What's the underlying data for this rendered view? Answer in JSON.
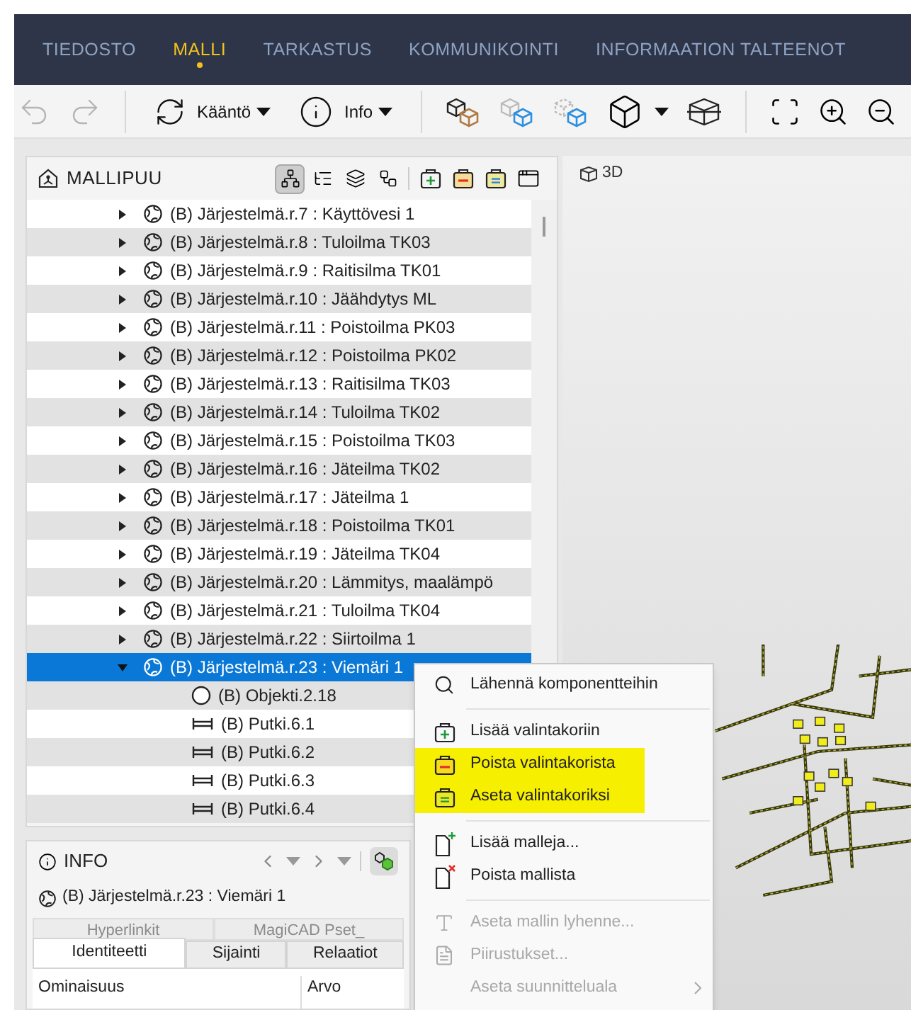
{
  "nav": {
    "tabs": [
      {
        "label": "TIEDOSTO",
        "selected": false
      },
      {
        "label": "MALLI",
        "selected": true
      },
      {
        "label": "TARKASTUS",
        "selected": false
      },
      {
        "label": "KOMMUNIKOINTI",
        "selected": false
      },
      {
        "label": "INFORMAATION TALTEENOT",
        "selected": false
      }
    ]
  },
  "toolbar": {
    "items": [
      {
        "kind": "undo",
        "disabled": true
      },
      {
        "kind": "redo",
        "disabled": true
      },
      {
        "kind": "separator"
      },
      {
        "kind": "rotate",
        "label": "Kääntö",
        "dropdown": true
      },
      {
        "kind": "info",
        "label": "Info",
        "dropdown": true
      },
      {
        "kind": "separator"
      },
      {
        "kind": "cubes-color"
      },
      {
        "kind": "cubes-ghost"
      },
      {
        "kind": "cubes-dashed"
      },
      {
        "kind": "cube",
        "dropdown": true
      },
      {
        "kind": "section-box"
      },
      {
        "kind": "separator"
      },
      {
        "kind": "zoom-fit"
      },
      {
        "kind": "zoom-in"
      },
      {
        "kind": "zoom-out"
      }
    ]
  },
  "model_tree": {
    "title": "MALLIPUU",
    "tools": [
      {
        "kind": "tree",
        "selected": true
      },
      {
        "kind": "list",
        "selected": false
      },
      {
        "kind": "layers",
        "selected": false
      },
      {
        "kind": "hierarchy",
        "selected": false
      },
      {
        "kind": "separator"
      },
      {
        "kind": "basket-add",
        "selected": false
      },
      {
        "kind": "basket-remove",
        "selected": false
      },
      {
        "kind": "basket-set",
        "selected": false
      },
      {
        "kind": "window",
        "selected": false
      }
    ],
    "rows": [
      {
        "kind": "system",
        "label": "(B) Järjestelmä.r.7 : Käyttövesi 1",
        "expanded": false,
        "selected": false
      },
      {
        "kind": "system",
        "label": "(B) Järjestelmä.r.8 : Tuloilma TK03",
        "expanded": false,
        "selected": false
      },
      {
        "kind": "system",
        "label": "(B) Järjestelmä.r.9 : Raitisilma TK01",
        "expanded": false,
        "selected": false
      },
      {
        "kind": "system",
        "label": "(B) Järjestelmä.r.10 : Jäähdytys ML",
        "expanded": false,
        "selected": false
      },
      {
        "kind": "system",
        "label": "(B) Järjestelmä.r.11 : Poistoilma PK03",
        "expanded": false,
        "selected": false
      },
      {
        "kind": "system",
        "label": "(B) Järjestelmä.r.12 : Poistoilma PK02",
        "expanded": false,
        "selected": false
      },
      {
        "kind": "system",
        "label": "(B) Järjestelmä.r.13 : Raitisilma TK03",
        "expanded": false,
        "selected": false
      },
      {
        "kind": "system",
        "label": "(B) Järjestelmä.r.14 : Tuloilma TK02",
        "expanded": false,
        "selected": false
      },
      {
        "kind": "system",
        "label": "(B) Järjestelmä.r.15 : Poistoilma TK03",
        "expanded": false,
        "selected": false
      },
      {
        "kind": "system",
        "label": "(B) Järjestelmä.r.16 : Jäteilma TK02",
        "expanded": false,
        "selected": false
      },
      {
        "kind": "system",
        "label": "(B) Järjestelmä.r.17 : Jäteilma 1",
        "expanded": false,
        "selected": false
      },
      {
        "kind": "system",
        "label": "(B) Järjestelmä.r.18 : Poistoilma TK01",
        "expanded": false,
        "selected": false
      },
      {
        "kind": "system",
        "label": "(B) Järjestelmä.r.19 : Jäteilma TK04",
        "expanded": false,
        "selected": false
      },
      {
        "kind": "system",
        "label": "(B) Järjestelmä.r.20 : Lämmitys, maalämpö",
        "expanded": false,
        "selected": false
      },
      {
        "kind": "system",
        "label": "(B) Järjestelmä.r.21 : Tuloilma TK04",
        "expanded": false,
        "selected": false
      },
      {
        "kind": "system",
        "label": "(B) Järjestelmä.r.22 : Siirtoilma 1",
        "expanded": false,
        "selected": false
      },
      {
        "kind": "system",
        "label": "(B) Järjestelmä.r.23 : Viemäri 1",
        "expanded": true,
        "selected": true,
        "children": [
          {
            "kind": "object",
            "label": "(B) Objekti.2.18",
            "selected": false
          },
          {
            "kind": "pipe",
            "label": "(B) Putki.6.1",
            "selected": false
          },
          {
            "kind": "pipe",
            "label": "(B) Putki.6.2",
            "selected": false
          },
          {
            "kind": "pipe",
            "label": "(B) Putki.6.3",
            "selected": false
          },
          {
            "kind": "pipe",
            "label": "(B) Putki.6.4",
            "selected": false
          }
        ]
      }
    ]
  },
  "viewport": {
    "title": "3D"
  },
  "info": {
    "title": "INFO",
    "subject": "(B) Järjestelmä.r.23 : Viemäri 1",
    "tabs_top": [
      {
        "label": "Hyperlinkit",
        "selected": false
      },
      {
        "label": "MagiCAD Pset_",
        "selected": false
      }
    ],
    "tabs": [
      {
        "label": "Identiteetti",
        "selected": true
      },
      {
        "label": "Sijainti",
        "selected": false
      },
      {
        "label": "Relaatiot",
        "selected": false
      }
    ],
    "columns": [
      "Ominaisuus",
      "Arvo"
    ]
  },
  "context_menu": {
    "items": [
      {
        "kind": "zoom",
        "label": "Lähennä komponentteihin",
        "disabled": false,
        "highlighted": false
      },
      {
        "kind": "separator"
      },
      {
        "kind": "basket-add",
        "label": "Lisää valintakoriin",
        "disabled": false,
        "highlighted": false
      },
      {
        "kind": "basket-remove",
        "label": "Poista valintakorista",
        "disabled": false,
        "highlighted": true
      },
      {
        "kind": "basket-set",
        "label": "Aseta valintakoriksi",
        "disabled": false,
        "highlighted": true
      },
      {
        "kind": "separator"
      },
      {
        "kind": "doc-add",
        "label": "Lisää malleja...",
        "disabled": false,
        "highlighted": false
      },
      {
        "kind": "doc-remove",
        "label": "Poista mallista",
        "disabled": false,
        "highlighted": false
      },
      {
        "kind": "separator"
      },
      {
        "kind": "abbrev",
        "label": "Aseta mallin lyhenne...",
        "disabled": true,
        "highlighted": false
      },
      {
        "kind": "drawings",
        "label": "Piirustukset...",
        "disabled": true,
        "highlighted": false
      },
      {
        "kind": "submenu",
        "label": "Aseta suunnitteluala",
        "disabled": true,
        "highlighted": false
      }
    ]
  }
}
